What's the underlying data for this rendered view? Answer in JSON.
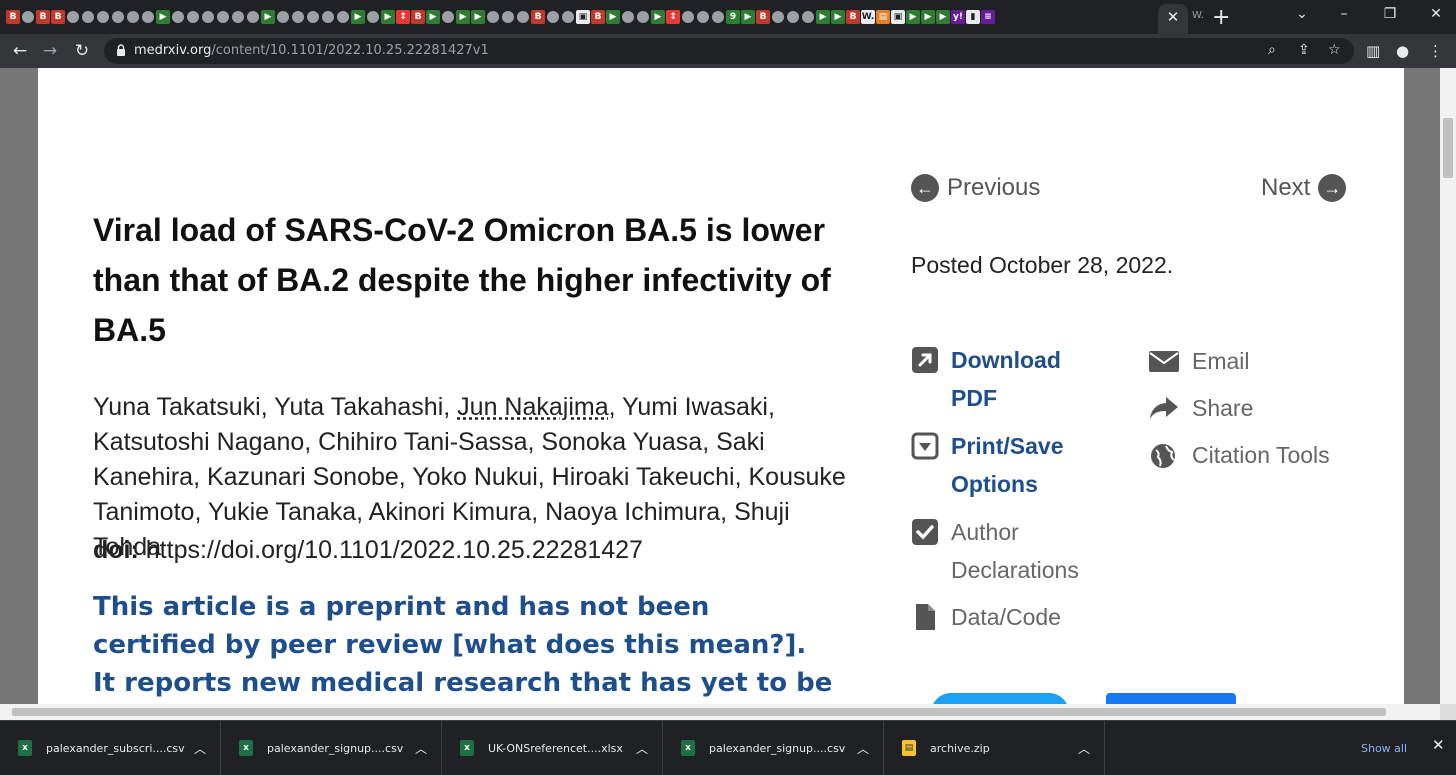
{
  "browser": {
    "url_domain": "medrxiv.org",
    "url_path": "/content/10.1101/2022.10.25.22281427v1",
    "active_tab_close": "✕",
    "tab_mini_label": "W.",
    "new_tab_label": "+",
    "favicons": [
      "B",
      "g",
      "B",
      "B",
      "g",
      "g",
      "g",
      "g",
      "g",
      "g",
      "▶",
      "g",
      "g",
      "g",
      "g",
      "g",
      "g",
      "▶",
      "g",
      "g",
      "g",
      "g",
      "g",
      "▶",
      "g",
      "▶",
      "↕",
      "B",
      "▶",
      "g",
      "▶",
      "▶",
      "g",
      "g",
      "g",
      "B",
      "g",
      "g",
      "▣",
      "B",
      "▶",
      "g",
      "g",
      "▶",
      "↕",
      "g",
      "g",
      "g",
      "9",
      "▶",
      "B",
      "g",
      "g",
      "g",
      "▶",
      "▶",
      "B",
      "W.",
      "▤",
      "▣",
      "▶",
      "▶",
      "▶",
      "y!",
      "▮",
      "≡"
    ]
  },
  "article": {
    "title": "Viral load of SARS-CoV-2 Omicron BA.5 is lower than that of BA.2 despite the higher infectivity of BA.5",
    "authors_before": "Yuna Takatsuki, Yuta Takahashi, ",
    "author_linked": "Jun Nakajima",
    "authors_after": ", Yumi Iwasaki, Katsutoshi Nagano, Chihiro Tani-Sassa, Sonoka Yuasa, Saki Kanehira, Kazunari Sonobe, Yoko Nukui, Hiroaki Takeuchi, Kousuke Tanimoto, Yukie Tanaka, Akinori Kimura, Naoya Ichimura, Shuji Tohda",
    "doi_label": "doi:",
    "doi_value": "https://doi.org/10.1101/2022.10.25.22281427",
    "preprint_notice": "This article is a preprint and has not been certified by peer review [what does this mean?]. It reports new medical research that has yet to be evaluated"
  },
  "sidebar": {
    "previous": "Previous",
    "next": "Next",
    "posted": "Posted October 28, 2022.",
    "actions": {
      "download_pdf": "Download PDF",
      "print_save": "Print/Save Options",
      "author_declarations": "Author Declarations",
      "data_code": "Data/Code",
      "email": "Email",
      "share": "Share",
      "citation_tools": "Citation Tools"
    },
    "colors": {
      "link": "#1f4e8c",
      "muted": "#666666",
      "twitter": "#1da1f2",
      "facebook": "#1877f2"
    }
  },
  "downloads": {
    "items": [
      {
        "name": "palexander_subscri....csv",
        "type": "excel"
      },
      {
        "name": "palexander_signup....csv",
        "type": "excel"
      },
      {
        "name": "UK-ONSreferencet....xlsx",
        "type": "excel"
      },
      {
        "name": "palexander_signup....csv",
        "type": "excel"
      },
      {
        "name": "archive.zip",
        "type": "zip"
      }
    ],
    "show_all": "Show all"
  }
}
